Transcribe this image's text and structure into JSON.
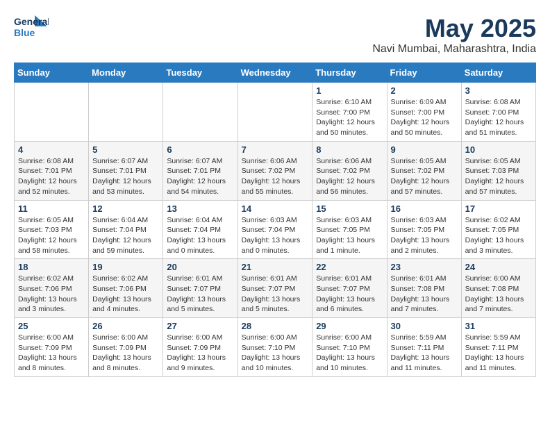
{
  "header": {
    "logo_line1": "General",
    "logo_line2": "Blue",
    "title": "May 2025",
    "subtitle": "Navi Mumbai, Maharashtra, India"
  },
  "days_of_week": [
    "Sunday",
    "Monday",
    "Tuesday",
    "Wednesday",
    "Thursday",
    "Friday",
    "Saturday"
  ],
  "weeks": [
    [
      {
        "num": "",
        "info": ""
      },
      {
        "num": "",
        "info": ""
      },
      {
        "num": "",
        "info": ""
      },
      {
        "num": "",
        "info": ""
      },
      {
        "num": "1",
        "info": "Sunrise: 6:10 AM\nSunset: 7:00 PM\nDaylight: 12 hours\nand 50 minutes."
      },
      {
        "num": "2",
        "info": "Sunrise: 6:09 AM\nSunset: 7:00 PM\nDaylight: 12 hours\nand 50 minutes."
      },
      {
        "num": "3",
        "info": "Sunrise: 6:08 AM\nSunset: 7:00 PM\nDaylight: 12 hours\nand 51 minutes."
      }
    ],
    [
      {
        "num": "4",
        "info": "Sunrise: 6:08 AM\nSunset: 7:01 PM\nDaylight: 12 hours\nand 52 minutes."
      },
      {
        "num": "5",
        "info": "Sunrise: 6:07 AM\nSunset: 7:01 PM\nDaylight: 12 hours\nand 53 minutes."
      },
      {
        "num": "6",
        "info": "Sunrise: 6:07 AM\nSunset: 7:01 PM\nDaylight: 12 hours\nand 54 minutes."
      },
      {
        "num": "7",
        "info": "Sunrise: 6:06 AM\nSunset: 7:02 PM\nDaylight: 12 hours\nand 55 minutes."
      },
      {
        "num": "8",
        "info": "Sunrise: 6:06 AM\nSunset: 7:02 PM\nDaylight: 12 hours\nand 56 minutes."
      },
      {
        "num": "9",
        "info": "Sunrise: 6:05 AM\nSunset: 7:02 PM\nDaylight: 12 hours\nand 57 minutes."
      },
      {
        "num": "10",
        "info": "Sunrise: 6:05 AM\nSunset: 7:03 PM\nDaylight: 12 hours\nand 57 minutes."
      }
    ],
    [
      {
        "num": "11",
        "info": "Sunrise: 6:05 AM\nSunset: 7:03 PM\nDaylight: 12 hours\nand 58 minutes."
      },
      {
        "num": "12",
        "info": "Sunrise: 6:04 AM\nSunset: 7:04 PM\nDaylight: 12 hours\nand 59 minutes."
      },
      {
        "num": "13",
        "info": "Sunrise: 6:04 AM\nSunset: 7:04 PM\nDaylight: 13 hours\nand 0 minutes."
      },
      {
        "num": "14",
        "info": "Sunrise: 6:03 AM\nSunset: 7:04 PM\nDaylight: 13 hours\nand 0 minutes."
      },
      {
        "num": "15",
        "info": "Sunrise: 6:03 AM\nSunset: 7:05 PM\nDaylight: 13 hours\nand 1 minute."
      },
      {
        "num": "16",
        "info": "Sunrise: 6:03 AM\nSunset: 7:05 PM\nDaylight: 13 hours\nand 2 minutes."
      },
      {
        "num": "17",
        "info": "Sunrise: 6:02 AM\nSunset: 7:05 PM\nDaylight: 13 hours\nand 3 minutes."
      }
    ],
    [
      {
        "num": "18",
        "info": "Sunrise: 6:02 AM\nSunset: 7:06 PM\nDaylight: 13 hours\nand 3 minutes."
      },
      {
        "num": "19",
        "info": "Sunrise: 6:02 AM\nSunset: 7:06 PM\nDaylight: 13 hours\nand 4 minutes."
      },
      {
        "num": "20",
        "info": "Sunrise: 6:01 AM\nSunset: 7:07 PM\nDaylight: 13 hours\nand 5 minutes."
      },
      {
        "num": "21",
        "info": "Sunrise: 6:01 AM\nSunset: 7:07 PM\nDaylight: 13 hours\nand 5 minutes."
      },
      {
        "num": "22",
        "info": "Sunrise: 6:01 AM\nSunset: 7:07 PM\nDaylight: 13 hours\nand 6 minutes."
      },
      {
        "num": "23",
        "info": "Sunrise: 6:01 AM\nSunset: 7:08 PM\nDaylight: 13 hours\nand 7 minutes."
      },
      {
        "num": "24",
        "info": "Sunrise: 6:00 AM\nSunset: 7:08 PM\nDaylight: 13 hours\nand 7 minutes."
      }
    ],
    [
      {
        "num": "25",
        "info": "Sunrise: 6:00 AM\nSunset: 7:09 PM\nDaylight: 13 hours\nand 8 minutes."
      },
      {
        "num": "26",
        "info": "Sunrise: 6:00 AM\nSunset: 7:09 PM\nDaylight: 13 hours\nand 8 minutes."
      },
      {
        "num": "27",
        "info": "Sunrise: 6:00 AM\nSunset: 7:09 PM\nDaylight: 13 hours\nand 9 minutes."
      },
      {
        "num": "28",
        "info": "Sunrise: 6:00 AM\nSunset: 7:10 PM\nDaylight: 13 hours\nand 10 minutes."
      },
      {
        "num": "29",
        "info": "Sunrise: 6:00 AM\nSunset: 7:10 PM\nDaylight: 13 hours\nand 10 minutes."
      },
      {
        "num": "30",
        "info": "Sunrise: 5:59 AM\nSunset: 7:11 PM\nDaylight: 13 hours\nand 11 minutes."
      },
      {
        "num": "31",
        "info": "Sunrise: 5:59 AM\nSunset: 7:11 PM\nDaylight: 13 hours\nand 11 minutes."
      }
    ]
  ]
}
